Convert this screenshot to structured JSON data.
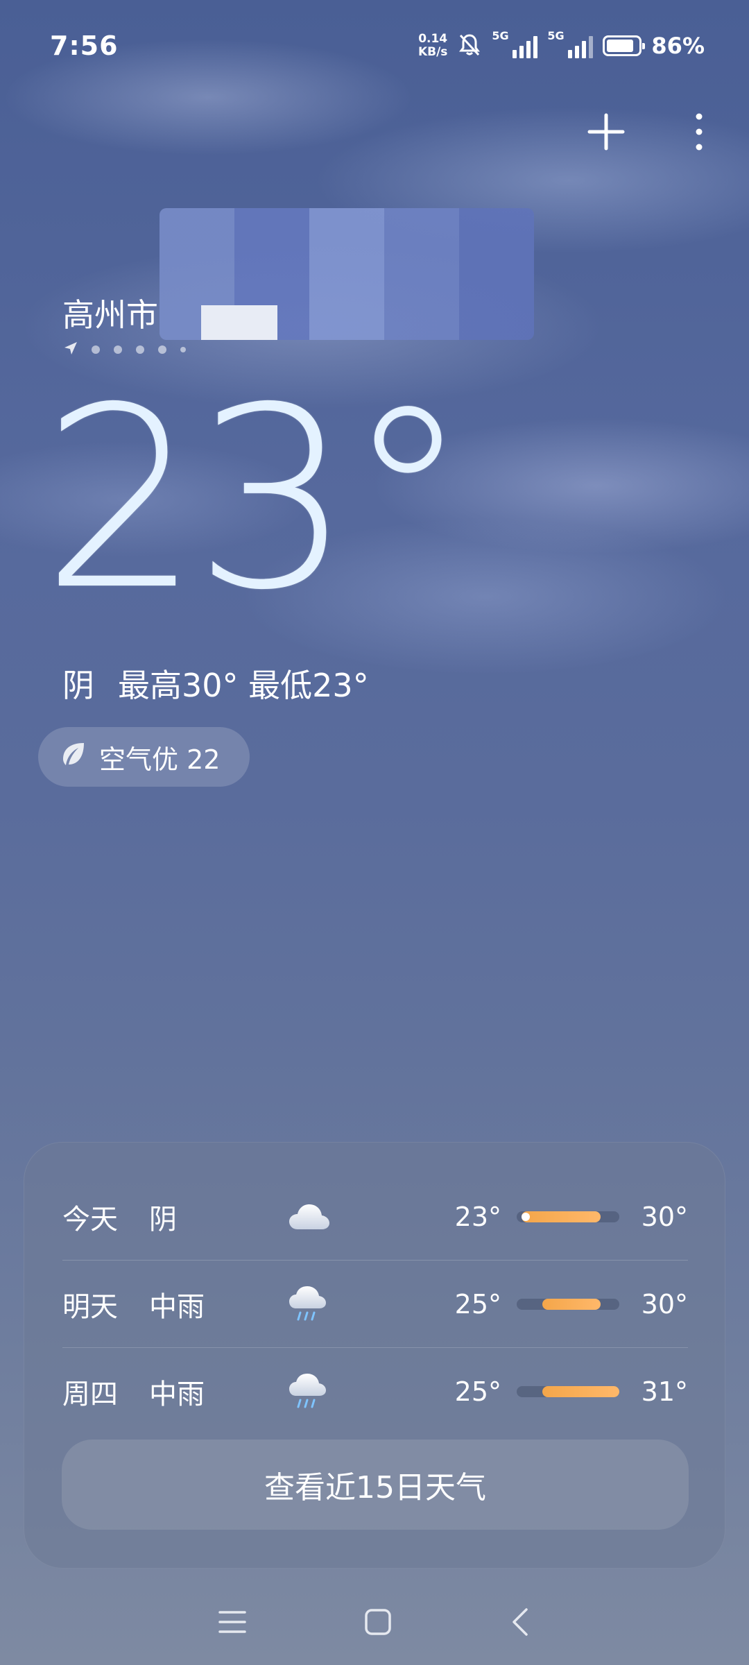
{
  "status_bar": {
    "time": "7:56",
    "net_speed_value": "0.14",
    "net_speed_unit": "KB/s",
    "signal1_tag": "5G",
    "signal2_tag": "5G",
    "battery_percent": "86%",
    "battery_level": 0.86
  },
  "location": {
    "city": "高州市"
  },
  "current": {
    "temperature": "23°",
    "condition": "阴",
    "high_low": "最高30° 最低23°",
    "aqi_label": "空气优 22"
  },
  "forecast": {
    "rows": [
      {
        "day": "今天",
        "condition": "阴",
        "icon": "cloud-icon",
        "low": "23°",
        "high": "30°",
        "bar_start": 0.05,
        "bar_end": 0.82,
        "show_dot": true
      },
      {
        "day": "明天",
        "condition": "中雨",
        "icon": "rain-icon",
        "low": "25°",
        "high": "30°",
        "bar_start": 0.25,
        "bar_end": 0.82,
        "show_dot": false
      },
      {
        "day": "周四",
        "condition": "中雨",
        "icon": "rain-icon",
        "low": "25°",
        "high": "31°",
        "bar_start": 0.25,
        "bar_end": 1.0,
        "show_dot": false
      }
    ],
    "cta_label": "查看近15日天气"
  },
  "colors": {
    "bar_fill": "#f4a64a",
    "temp_text": "#e4f2ff"
  }
}
